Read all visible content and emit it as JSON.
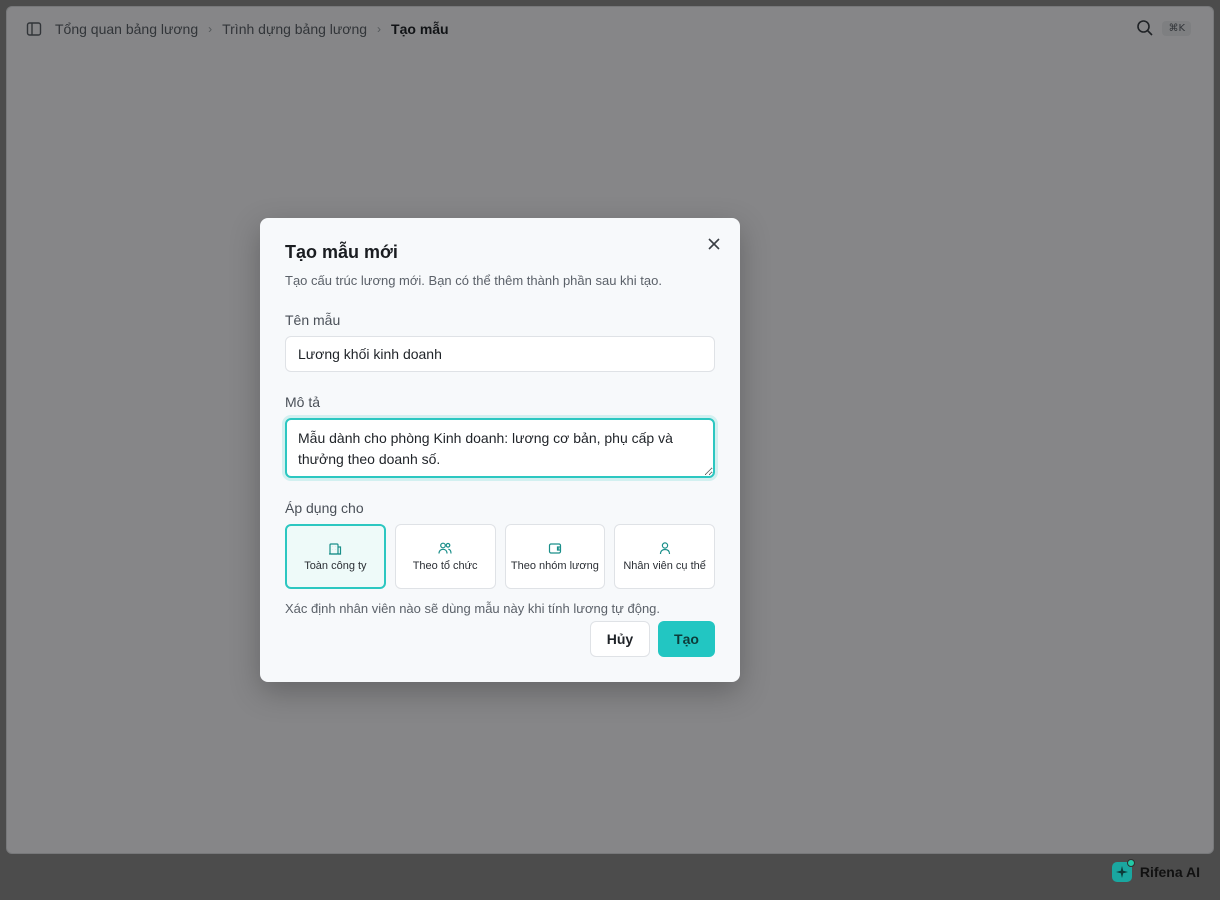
{
  "breadcrumb": {
    "items": [
      "Tổng quan bảng lương",
      "Trình dựng bảng lương",
      "Tạo mẫu"
    ]
  },
  "topbar": {
    "shortcut": "⌘K"
  },
  "assistant": {
    "label": "Rifena AI"
  },
  "dialog": {
    "title": "Tạo mẫu mới",
    "description": "Tạo cấu trúc lương mới. Bạn có thể thêm thành phần sau khi tạo.",
    "name_label": "Tên mẫu",
    "name_value": "Lương khối kinh doanh",
    "desc_label": "Mô tả",
    "desc_value": "Mẫu dành cho phòng Kinh doanh: lương cơ bản, phụ cấp và thưởng theo doanh số.",
    "apply_label": "Áp dụng cho",
    "options": [
      {
        "label": "Toàn công ty",
        "icon": "building-icon",
        "selected": true
      },
      {
        "label": "Theo tổ chức",
        "icon": "users-icon",
        "selected": false
      },
      {
        "label": "Theo nhóm lương",
        "icon": "wallet-icon",
        "selected": false
      },
      {
        "label": "Nhân viên cụ thể",
        "icon": "user-icon",
        "selected": false
      }
    ],
    "hint": "Xác định nhân viên nào sẽ dùng mẫu này khi tính lương tự động.",
    "cancel_label": "Hủy",
    "submit_label": "Tạo"
  },
  "colors": {
    "accent": "#22c6c2",
    "accent_border": "#2cc7c1"
  }
}
